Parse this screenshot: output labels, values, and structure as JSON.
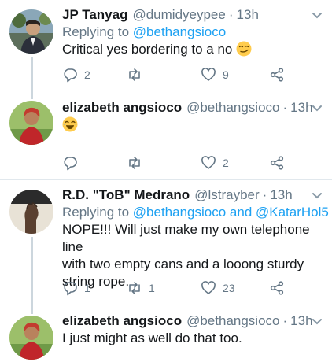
{
  "tweets": [
    {
      "name": "JP Tanyag",
      "handle": "@dumidyeypee",
      "dot": "·",
      "time": "13h",
      "replying_prefix": "Replying to",
      "replying_to": "@bethangsioco",
      "text": "Critical yes bordering to a no",
      "emoji": "smirking-face",
      "replies": "2",
      "retweets": "",
      "likes": "9"
    },
    {
      "name": "elizabeth angsioco",
      "handle": "@bethangsioco",
      "dot": "·",
      "time": "13h",
      "emoji": "face-with-tears-of-joy",
      "replies": "",
      "retweets": "",
      "likes": "2"
    },
    {
      "name": "R.D. \"ToB\" Medrano",
      "handle": "@lstrayber",
      "dot": "·",
      "time": "13h",
      "replying_prefix": "Replying to",
      "replying_to": "@bethangsioco and @KatarHol5",
      "text_lines": [
        "NOPE!!! Will just make my own telephone line",
        "with two empty cans and a looong sturdy",
        "string rope."
      ],
      "replies": "1",
      "retweets": "1",
      "likes": "23"
    },
    {
      "name": "elizabeth angsioco",
      "handle": "@bethangsioco",
      "dot": "·",
      "time": "13h",
      "text": "I just might as well do that too."
    }
  ],
  "colors": {
    "text": "#14171a",
    "secondary": "#657786",
    "link": "#1da1f2",
    "thread_line": "#ccd6dd",
    "divider": "#e1e8ed"
  },
  "icons": [
    "reply-icon",
    "retweet-icon",
    "like-icon",
    "share-icon",
    "chevron-down-icon"
  ]
}
